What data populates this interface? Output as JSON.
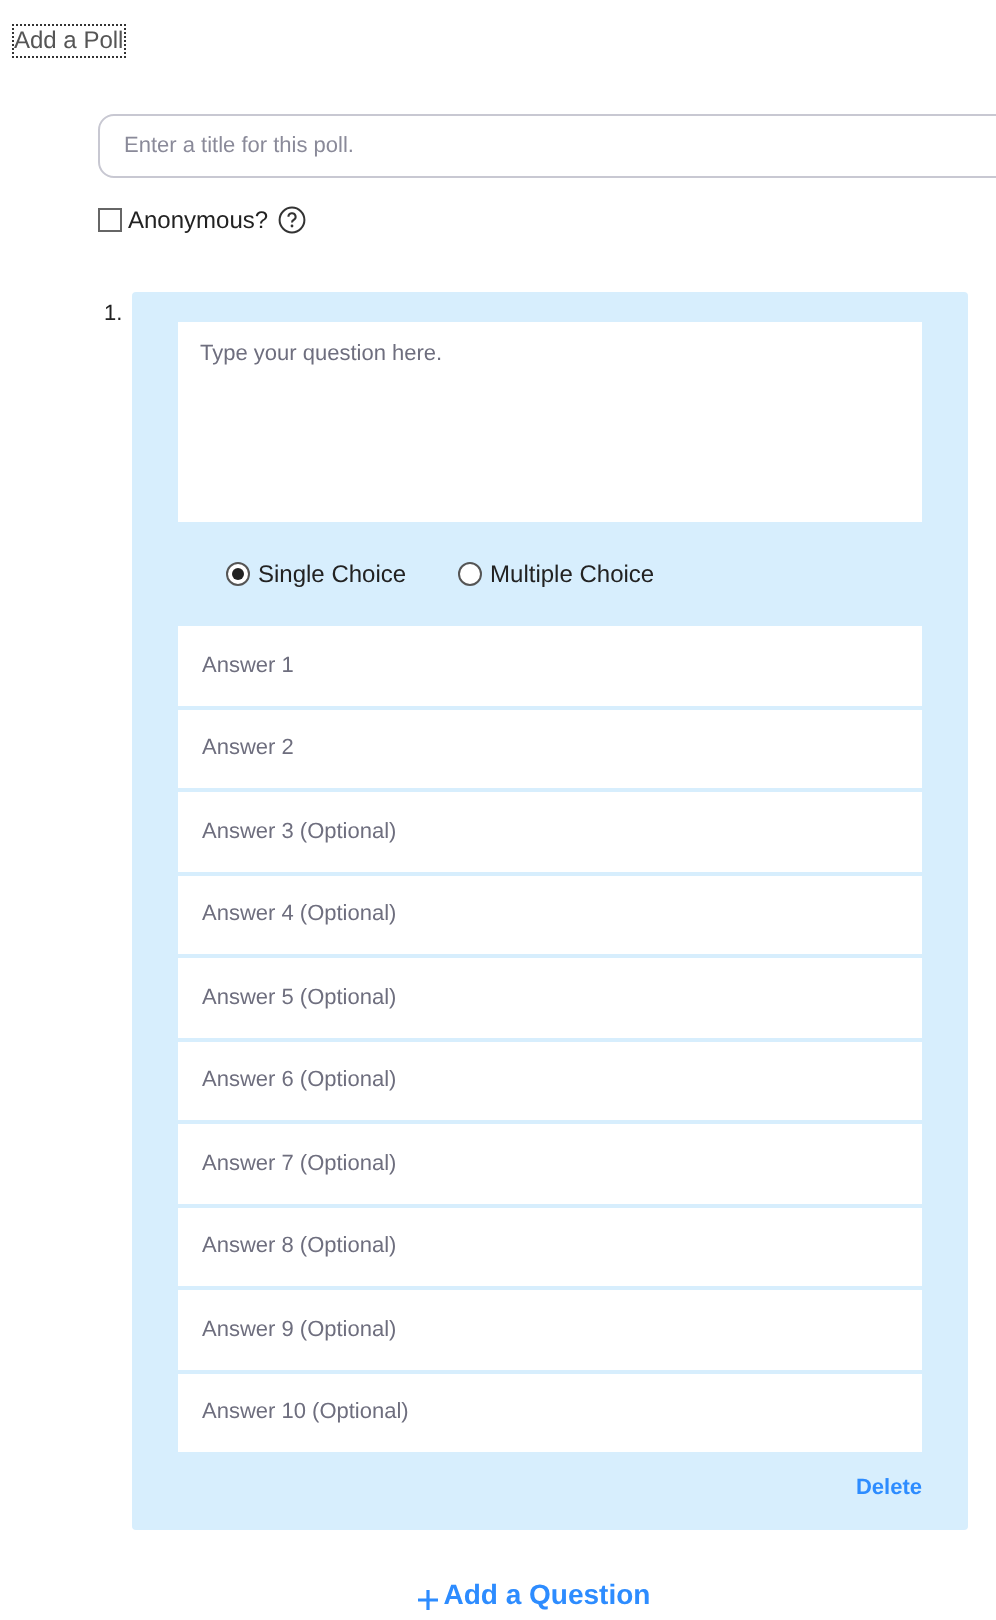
{
  "title": "Add a Poll",
  "poll_title": {
    "placeholder": "Enter a title for this poll."
  },
  "anonymous": {
    "label": "Anonymous?",
    "checked": false
  },
  "questions": [
    {
      "number": "1.",
      "question": {
        "placeholder": "Type your question here."
      },
      "choice_types": [
        {
          "label": "Single Choice",
          "selected": true
        },
        {
          "label": "Multiple Choice",
          "selected": false
        }
      ],
      "answers": [
        {
          "placeholder": "Answer 1"
        },
        {
          "placeholder": "Answer 2"
        },
        {
          "placeholder": "Answer 3 (Optional)"
        },
        {
          "placeholder": "Answer 4 (Optional)"
        },
        {
          "placeholder": "Answer 5 (Optional)"
        },
        {
          "placeholder": "Answer 6 (Optional)"
        },
        {
          "placeholder": "Answer 7 (Optional)"
        },
        {
          "placeholder": "Answer 8 (Optional)"
        },
        {
          "placeholder": "Answer 9 (Optional)"
        },
        {
          "placeholder": "Answer 10 (Optional)"
        }
      ],
      "delete": "Delete"
    }
  ],
  "add_question": "Add a Question"
}
